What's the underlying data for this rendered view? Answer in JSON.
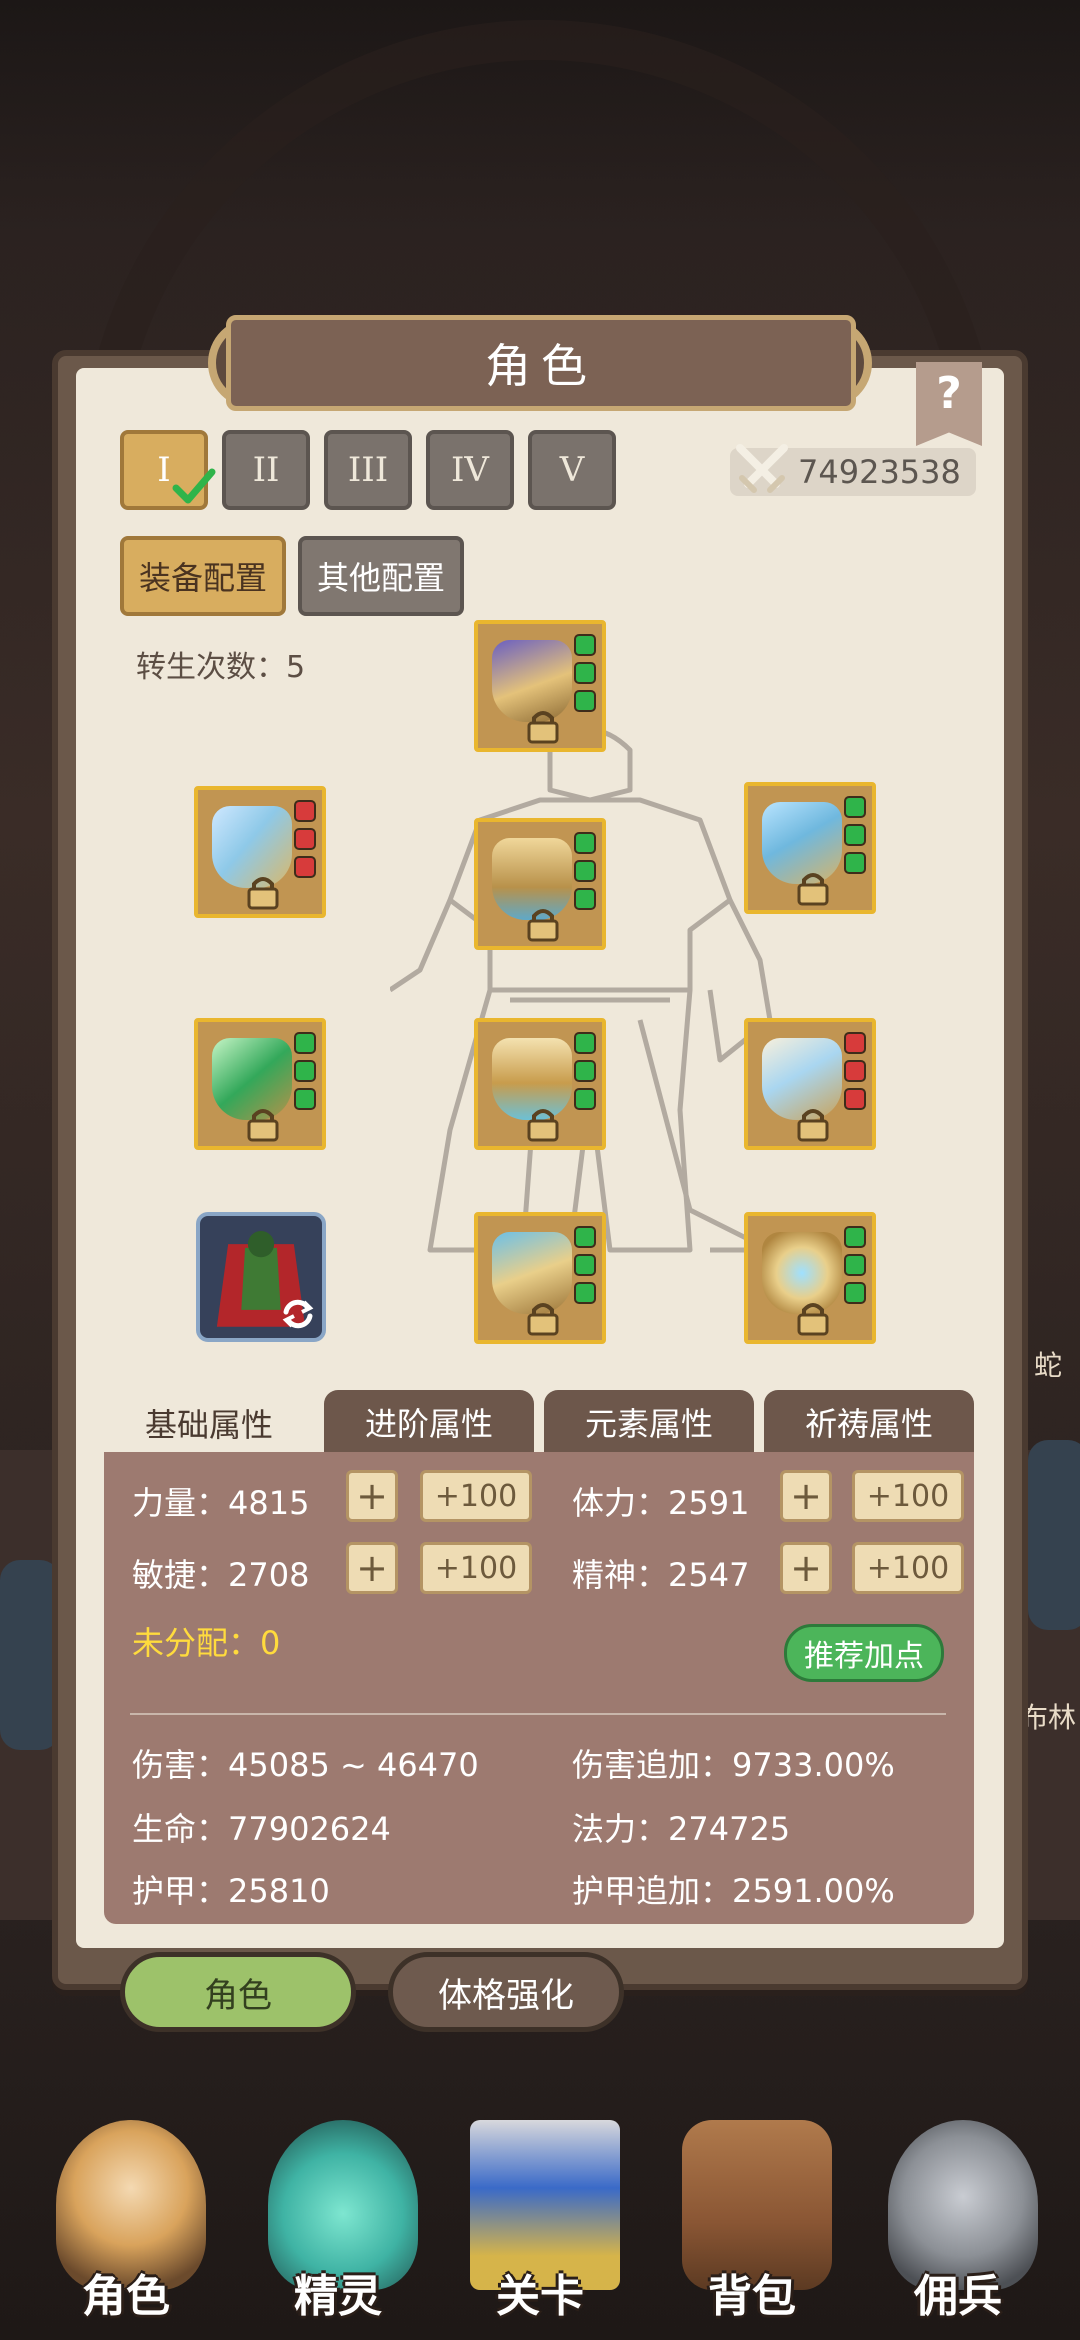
{
  "title": "角色",
  "help_label": "?",
  "slot_tabs": [
    "I",
    "II",
    "III",
    "IV",
    "V"
  ],
  "combat_power": "74923538",
  "config_tabs": [
    "装备配置",
    "其他配置"
  ],
  "rebirth_label": "转生次数：5",
  "attr_tabs": [
    "基础属性",
    "进阶属性",
    "元素属性",
    "祈祷属性"
  ],
  "base_attrs": [
    {
      "label": "力量：4815",
      "plus": "+",
      "plus100": "+100"
    },
    {
      "label": "体力：2591",
      "plus": "+",
      "plus100": "+100"
    },
    {
      "label": "敏捷：2708",
      "plus": "+",
      "plus100": "+100"
    },
    {
      "label": "精神：2547",
      "plus": "+",
      "plus100": "+100"
    }
  ],
  "unallocated": "未分配：0",
  "recommend_label": "推荐加点",
  "stats": [
    "伤害：45085 ~ 46470",
    "伤害追加：9733.00%",
    "生命：77902624",
    "法力：274725",
    "护甲：25810",
    "护甲追加：2591.00%"
  ],
  "bottom_tabs": [
    "角色",
    "体格强化"
  ],
  "nav": [
    "角色",
    "精灵",
    "关卡",
    "背包",
    "佣兵"
  ],
  "bg_labels": [
    "蛇",
    "布林"
  ],
  "colors": {
    "accent": "#d8ad5f",
    "panel": "#9d7a70",
    "green": "#4cb55a",
    "yellow": "#ffdb3d"
  }
}
